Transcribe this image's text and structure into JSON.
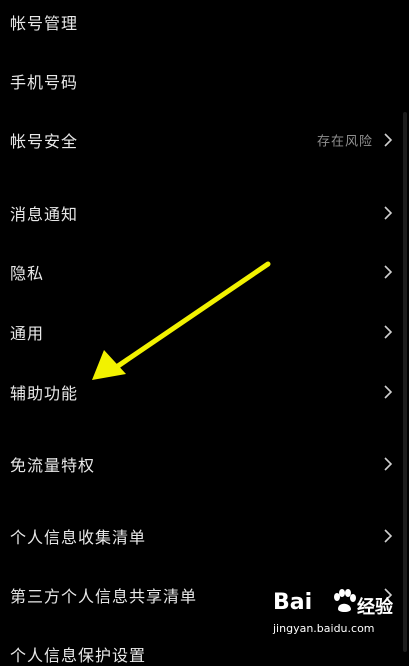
{
  "settings": {
    "items": [
      {
        "label": "帐号管理",
        "status": "",
        "chevron": false
      },
      {
        "label": "手机号码",
        "status": "",
        "chevron": false
      },
      {
        "label": "帐号安全",
        "status": "存在风险",
        "chevron": true
      },
      {
        "label": "消息通知",
        "status": "",
        "chevron": true
      },
      {
        "label": "隐私",
        "status": "",
        "chevron": true
      },
      {
        "label": "通用",
        "status": "",
        "chevron": true
      },
      {
        "label": "辅助功能",
        "status": "",
        "chevron": true
      },
      {
        "label": "免流量特权",
        "status": "",
        "chevron": true
      },
      {
        "label": "个人信息收集清单",
        "status": "",
        "chevron": true
      },
      {
        "label": "第三方个人信息共享清单",
        "status": "",
        "chevron": true
      }
    ],
    "partial_item_label": "个人信息保护设置"
  },
  "annotation": {
    "arrow_color": "#f2f200",
    "points_to": "辅助功能"
  },
  "watermark": {
    "brand": "Bai",
    "paw_suffix": "经验",
    "url": "jingyan.baidu.com"
  },
  "colors": {
    "background": "#000000",
    "text": "#e8e8e8",
    "status_text": "#8f8f8f"
  }
}
